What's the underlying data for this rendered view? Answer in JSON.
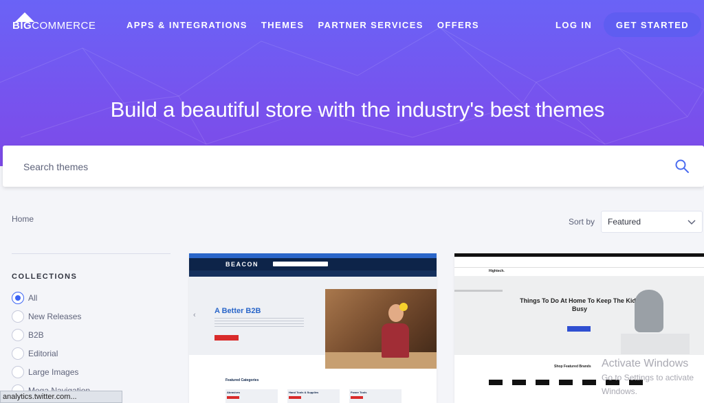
{
  "header": {
    "logo_big": "BIG",
    "logo_commerce": "COMMERCE",
    "nav": [
      "APPS & INTEGRATIONS",
      "THEMES",
      "PARTNER SERVICES",
      "OFFERS"
    ],
    "login": "LOG IN",
    "get_started": "GET STARTED"
  },
  "hero": {
    "title": "Build a beautiful store with the industry's best themes"
  },
  "search": {
    "placeholder": "Search themes",
    "icon": "search-icon"
  },
  "breadcrumb": "Home",
  "sort": {
    "label": "Sort by",
    "selected": "Featured"
  },
  "collections": {
    "title": "COLLECTIONS",
    "items": [
      {
        "label": "All",
        "selected": true
      },
      {
        "label": "New Releases",
        "selected": false
      },
      {
        "label": "B2B",
        "selected": false
      },
      {
        "label": "Editorial",
        "selected": false
      },
      {
        "label": "Large Images",
        "selected": false
      },
      {
        "label": "Mega Navigation",
        "selected": false
      }
    ]
  },
  "cards": [
    {
      "name": "beacon",
      "brand": "BEACON",
      "headline": "A Better B2B",
      "section": "Featured Categories",
      "categories": [
        "Abrasives",
        "Hand Tools & Supplies",
        "Power Tools"
      ]
    },
    {
      "name": "hightech",
      "brand": "Hightech.",
      "headline": "Things To Do At Home To Keep The Kids Busy",
      "section": "Shop Featured Brands"
    }
  ],
  "watermark": {
    "line1": "Activate Windows",
    "line2": "Go to Settings to activate Windows."
  },
  "statusbar": "analytics.twitter.com...",
  "colors": {
    "hero_start": "#6a63f6",
    "hero_end": "#7d4ae8",
    "accent": "#3c64f4",
    "get_started_bg": "#5f5df1"
  }
}
